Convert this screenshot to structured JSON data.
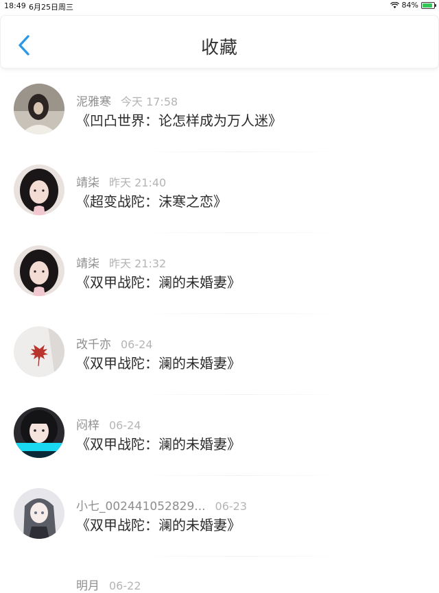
{
  "status": {
    "time": "18:49",
    "date": "6月25日周三",
    "battery": "84%"
  },
  "header": {
    "title": "收藏"
  },
  "items": [
    {
      "user": "泥雅寒",
      "time": "今天 17:58",
      "title": "《凹凸世界：论怎样成为万人迷》",
      "avatar": "portrait-dark-hair"
    },
    {
      "user": "靖柒",
      "time": "昨天 21:40",
      "title": "《超变战陀：沫寒之恋》",
      "avatar": "portrait-girl"
    },
    {
      "user": "靖柒",
      "time": "昨天 21:32",
      "title": "《双甲战陀：澜的未婚妻》",
      "avatar": "portrait-girl"
    },
    {
      "user": "改千亦",
      "time": "06-24",
      "title": "《双甲战陀：澜的未婚妻》",
      "avatar": "maple-leaf"
    },
    {
      "user": "闷梓",
      "time": "06-24",
      "title": "《双甲战陀：澜的未婚妻》",
      "avatar": "portrait-girl-cyan"
    },
    {
      "user": "小七_002441052829...",
      "time": "06-23",
      "title": "《双甲战陀：澜的未婚妻》",
      "avatar": "anime-girl"
    }
  ],
  "partial_item": {
    "user": "明月",
    "time": "06-22"
  }
}
